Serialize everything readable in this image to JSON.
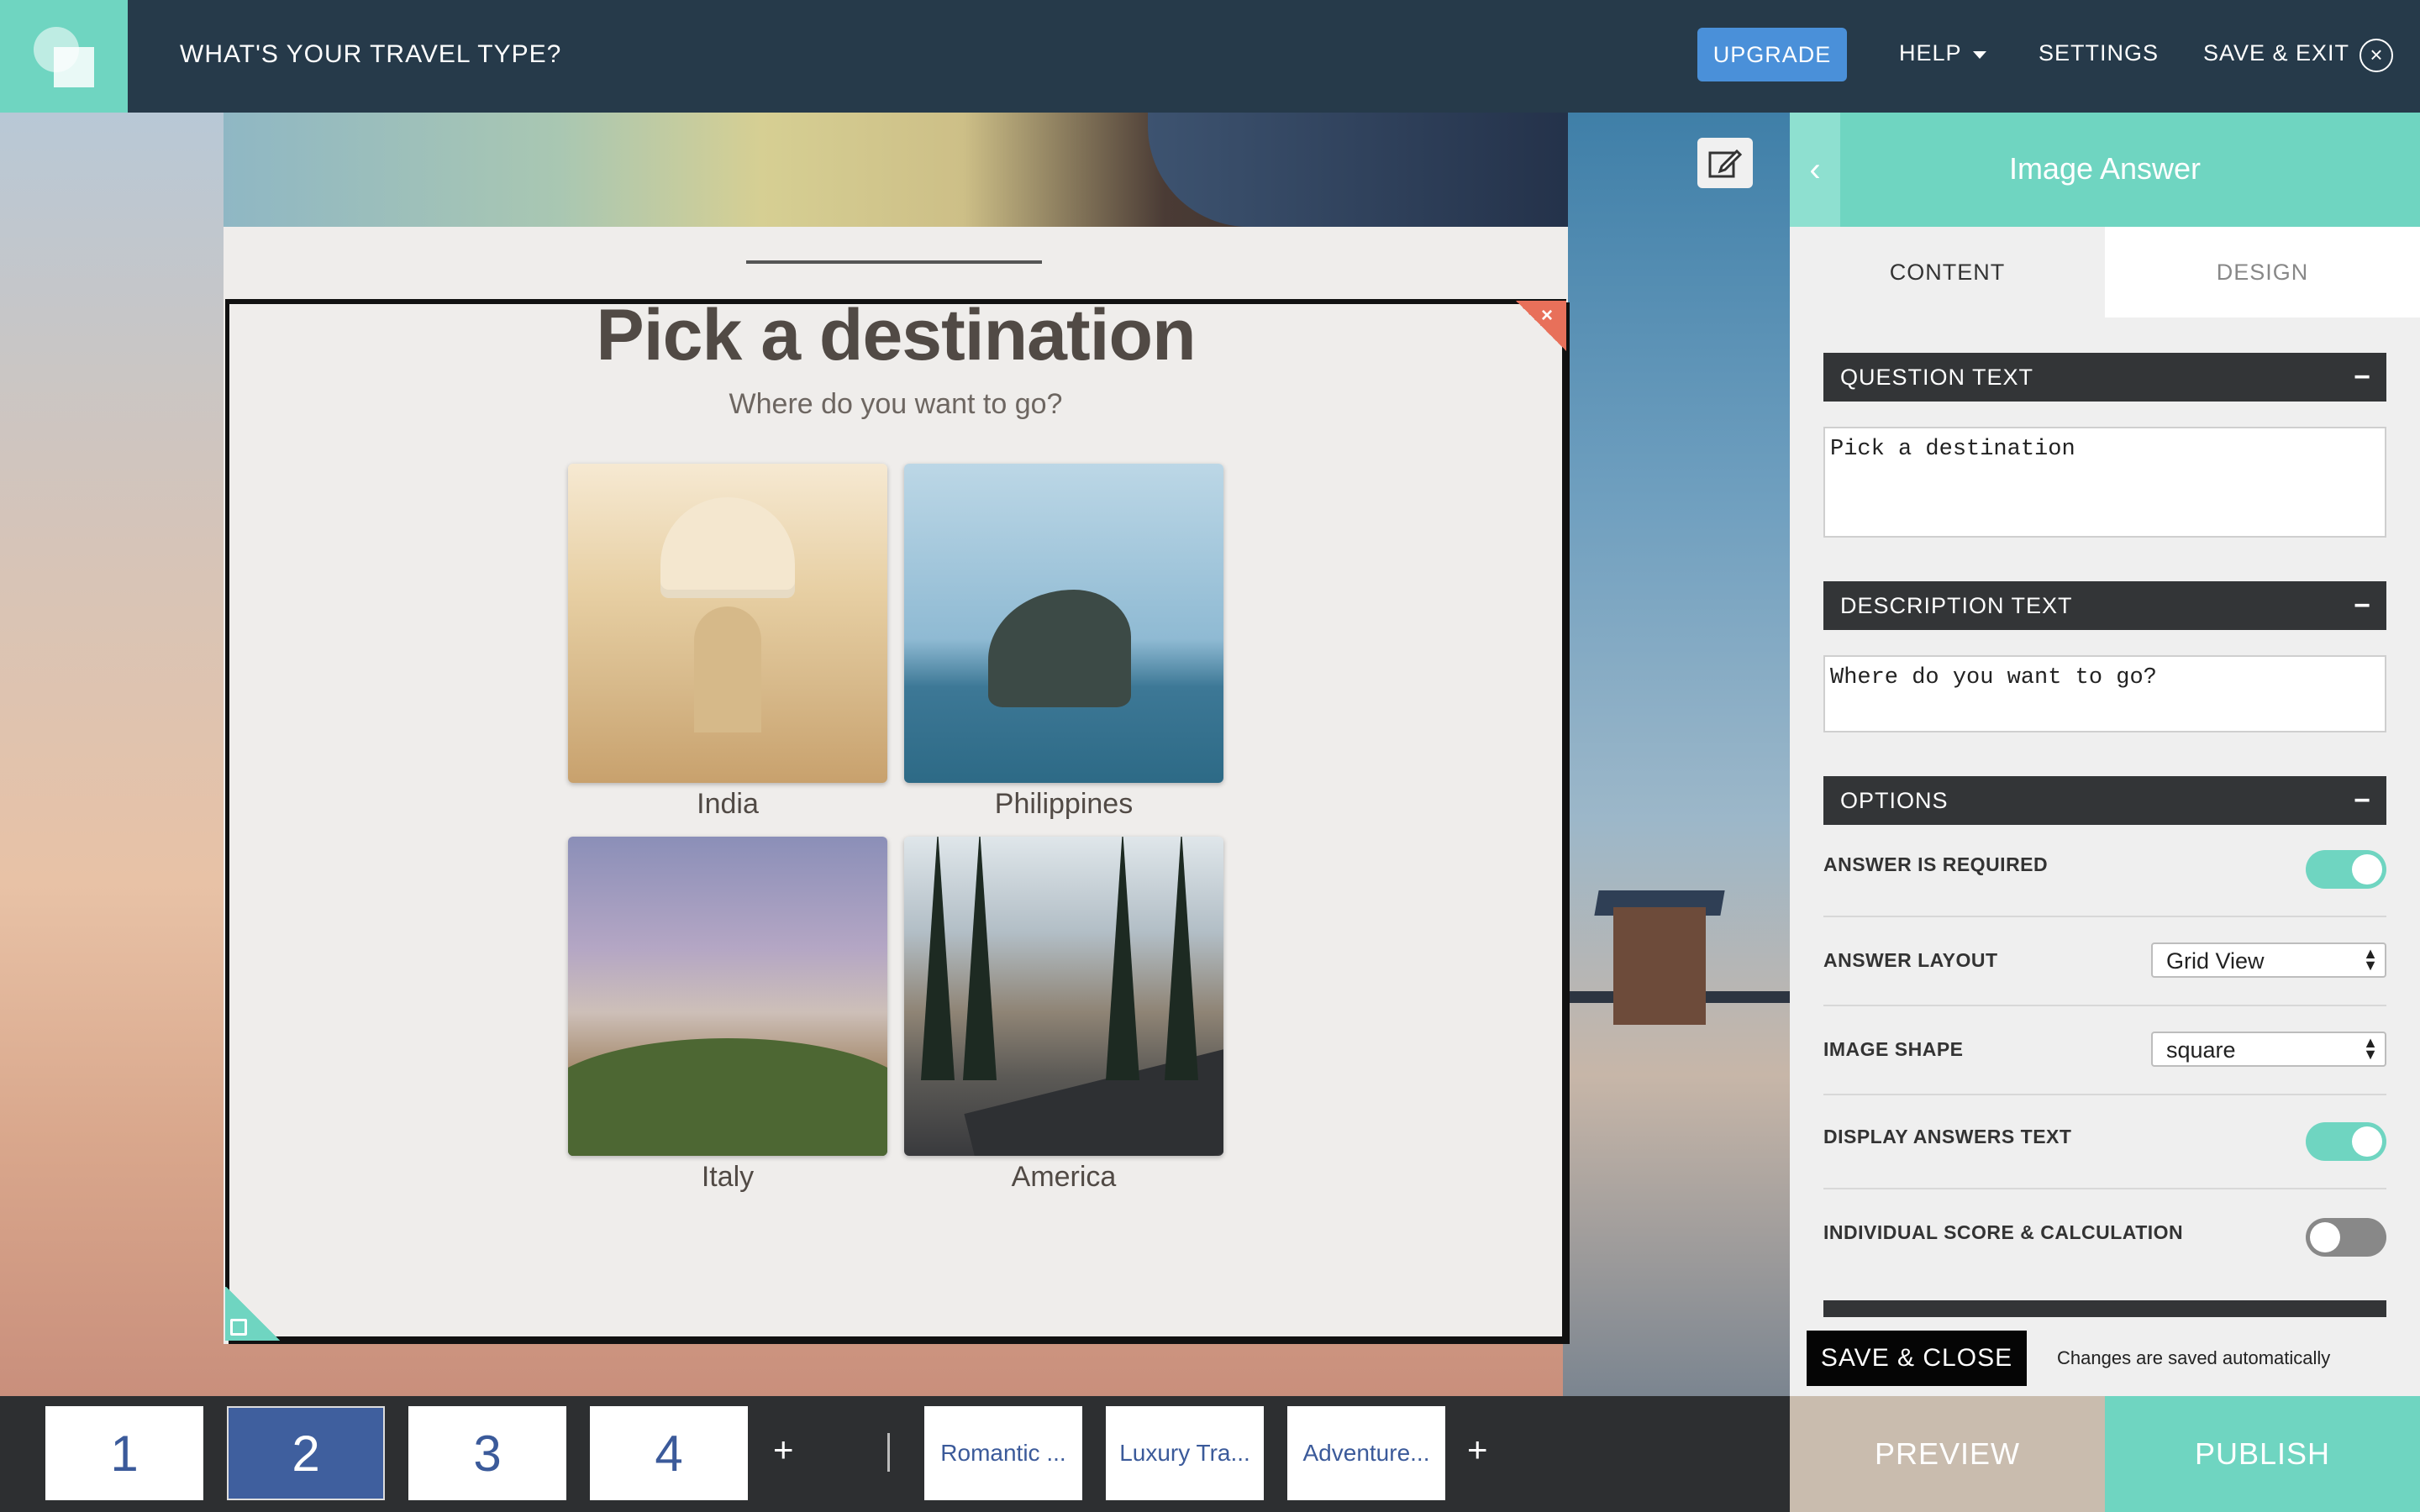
{
  "header": {
    "title": "WHAT'S YOUR TRAVEL TYPE?",
    "upgrade_label": "UPGRADE",
    "help_label": "HELP",
    "settings_label": "SETTINGS",
    "save_exit_label": "SAVE & EXIT",
    "close_glyph": "×"
  },
  "editor": {
    "question_title": "Pick a destination",
    "question_description": "Where do you want to go?",
    "delete_glyph": "×",
    "answers": [
      {
        "label": "India"
      },
      {
        "label": "Philippines"
      },
      {
        "label": "Italy"
      },
      {
        "label": "America"
      }
    ]
  },
  "panel": {
    "back_glyph": "‹",
    "title": "Image Answer",
    "tabs": [
      {
        "label": "CONTENT",
        "active": true
      },
      {
        "label": "DESIGN",
        "active": false
      }
    ],
    "question_text_header": "QUESTION TEXT",
    "question_text_value": "Pick a destination",
    "description_text_header": "DESCRIPTION TEXT",
    "description_text_value": "Where do you want to go?",
    "options_header": "OPTIONS",
    "collapse_glyph": "−",
    "options": {
      "answer_required": {
        "label": "ANSWER IS REQUIRED",
        "enabled": true
      },
      "answer_layout": {
        "label": "ANSWER LAYOUT",
        "value": "Grid View"
      },
      "image_shape": {
        "label": "IMAGE SHAPE",
        "value": "square"
      },
      "display_answers_text": {
        "label": "DISPLAY ANSWERS TEXT",
        "enabled": true
      },
      "individual_score": {
        "label": "INDIVIDUAL SCORE & CALCULATION",
        "enabled": false
      }
    },
    "save_close_label": "SAVE & CLOSE",
    "autosave_text": "Changes are saved automatically"
  },
  "bottom": {
    "pages": [
      {
        "label": "1",
        "active": false
      },
      {
        "label": "2",
        "active": true
      },
      {
        "label": "3",
        "active": false
      },
      {
        "label": "4",
        "active": false
      }
    ],
    "add_glyph": "+",
    "results": [
      {
        "label": "Romantic ..."
      },
      {
        "label": "Luxury Tra..."
      },
      {
        "label": "Adventure..."
      }
    ],
    "preview_label": "PREVIEW",
    "publish_label": "PUBLISH"
  },
  "colors": {
    "accent": "#6fd5c1",
    "topbar": "#263a4a",
    "upgrade": "#4a90d9",
    "active_page": "#3f5f9e",
    "delete": "#e8705a"
  }
}
